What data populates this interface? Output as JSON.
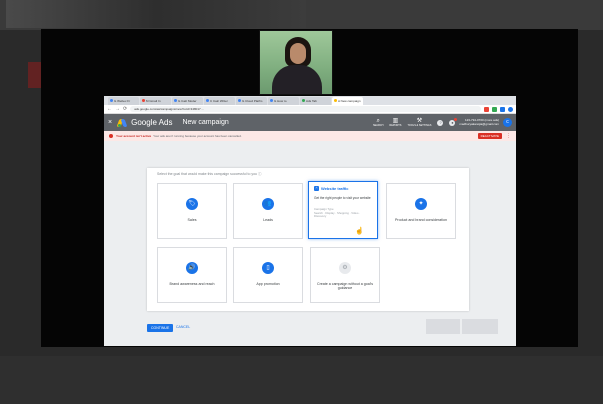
{
  "browser": {
    "tabs": [
      {
        "label": "G Webex Fr"
      },
      {
        "label": "M Gmail In"
      },
      {
        "label": "G Calc Moder"
      },
      {
        "label": "C Calc Writer"
      },
      {
        "label": "G Cloud Platfm"
      },
      {
        "label": "G How to"
      },
      {
        "label": "Ads Tab"
      },
      {
        "label": "A New campaign",
        "active": true
      }
    ],
    "url": "ads.google.com/aw/campaigns/new?ocid=348017 ...",
    "back_icon": "arrow-left",
    "forward_icon": "arrow-right",
    "reload_icon": "reload"
  },
  "appbar": {
    "close_glyph": "×",
    "product_name": "Google Ads",
    "page_title": "New campaign",
    "tools": [
      {
        "label": "SEARCH",
        "glyph": "⌕"
      },
      {
        "label": "REPORTS",
        "glyph": "▥"
      },
      {
        "label": "TOOLS & SETTINGS",
        "glyph": "⚒"
      }
    ],
    "help_glyph": "?",
    "bell_glyph": "●",
    "account_id": "123-734-0700 (more ads)",
    "account_email": "madhuryakanojia@gmail.com",
    "avatar_letter": "c"
  },
  "alert": {
    "title": "Your account isn't active",
    "message": "Your ads aren't running because your account has been cancelled.",
    "action_label": "REACTIVATE",
    "more_glyph": "⋮"
  },
  "goals": {
    "prompt": "Select the goal that would make this campaign successful to you ⓘ",
    "items": [
      {
        "label": "Sales",
        "glyph": "🏷"
      },
      {
        "label": "Leads",
        "glyph": "👥"
      },
      {
        "label": "Product and brand consideration",
        "glyph": "✦"
      },
      {
        "label": "Brand awareness and reach",
        "glyph": "🔊"
      },
      {
        "label": "App promotion",
        "glyph": "▯"
      },
      {
        "label": "Create a campaign without a goal's guidance",
        "glyph": "⚙"
      }
    ],
    "selected": {
      "title": "Website traffic",
      "glyph": "🖱",
      "description": "Get the right people to visit your website",
      "control_label": "Campaign Type",
      "control_options": "Search · Display · Shopping · Video · Discovery",
      "cursor_glyph": "☝"
    }
  },
  "footer": {
    "continue_label": "CONTINUE",
    "cancel_label": "CANCEL"
  },
  "webcam": {
    "background_color": "#8fbf8a"
  },
  "colors": {
    "accent": "#1a73e8",
    "appbar": "#5f6368",
    "alert_bg": "#fce8e6",
    "alert_red": "#d93025"
  }
}
